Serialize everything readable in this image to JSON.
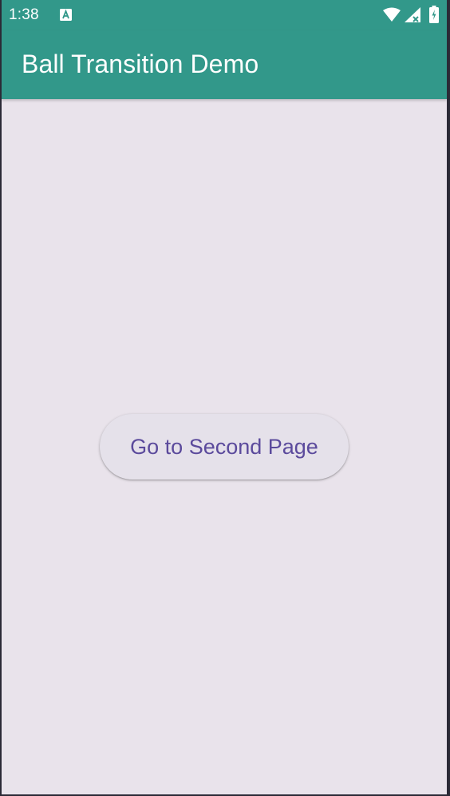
{
  "status_bar": {
    "time": "1:38",
    "notification_icon": "text-a-icon",
    "wifi_icon": "wifi-icon",
    "signal_icon": "cell-signal-icon",
    "battery_icon": "battery-charging-icon"
  },
  "app_bar": {
    "title": "Ball Transition Demo"
  },
  "main": {
    "button_label": "Go to Second Page"
  },
  "colors": {
    "primary": "#32988a",
    "background": "#e9e3eb",
    "button_background": "#e5e1ea",
    "button_text": "#5b4a9c"
  }
}
